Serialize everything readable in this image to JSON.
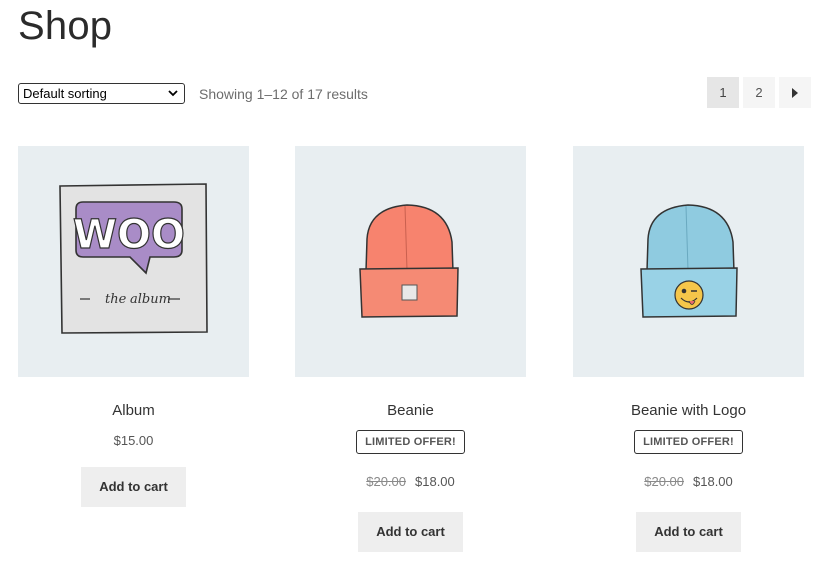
{
  "page": {
    "title": "Shop"
  },
  "toolbar": {
    "sort_selected": "Default sorting",
    "result_count": "Showing 1–12 of 17 results"
  },
  "pagination": {
    "pages": [
      "1",
      "2"
    ],
    "current": "1",
    "next_icon": "chevron-right-icon"
  },
  "products": [
    {
      "name": "Album",
      "badge": "",
      "regular_price": "",
      "price": "$15.00",
      "button": "Add to cart",
      "image": "woo-album-image"
    },
    {
      "name": "Beanie",
      "badge": "LIMITED OFFER!",
      "regular_price": "$20.00",
      "price": "$18.00",
      "button": "Add to cart",
      "image": "orange-beanie-image"
    },
    {
      "name": "Beanie with Logo",
      "badge": "LIMITED OFFER!",
      "regular_price": "$20.00",
      "price": "$18.00",
      "button": "Add to cart",
      "image": "blue-beanie-logo-image"
    }
  ],
  "colors": {
    "image_bg": "#e8eef1",
    "button_bg": "#eeeeee",
    "album_purple": "#a98cc7",
    "beanie_orange": "#f7836e",
    "beanie_blue": "#8fcbe0"
  }
}
